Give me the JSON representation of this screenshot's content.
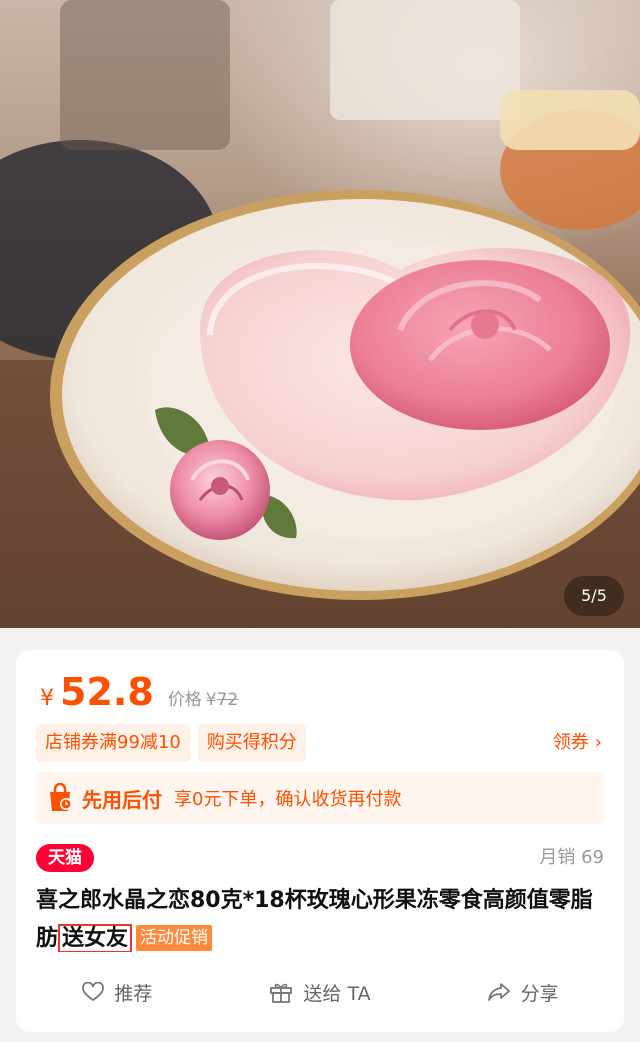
{
  "gallery": {
    "page_indicator": "5/5",
    "image_subject": "rose-shaped pink jelly in heart-shaped cup on white plate"
  },
  "price": {
    "currency": "¥",
    "current": "52.8",
    "label": "价格",
    "original_currency": "¥",
    "original": "72"
  },
  "coupons": [
    "店铺券满99减10",
    "购买得积分"
  ],
  "claim_label": "领券",
  "pay_later": {
    "icon": "bag-icon",
    "title": "先用后付",
    "desc": "享0元下单，确认收货再付款"
  },
  "badge": "天猫",
  "sales": "月销 69",
  "product_title": {
    "main": "喜之郎水晶之恋80克*18杯玫瑰心形果冻零食高颜值零脂肪",
    "highlight": "送女友",
    "promo_tag": "活动促销"
  },
  "actions": [
    {
      "icon": "heart-icon",
      "label": "推荐"
    },
    {
      "icon": "gift-icon",
      "label": "送给 TA"
    },
    {
      "icon": "share-icon",
      "label": "分享"
    }
  ],
  "colors": {
    "accent": "#ff5000",
    "tmall_red": "#ff0036",
    "promo_orange": "#ff8a3c"
  }
}
